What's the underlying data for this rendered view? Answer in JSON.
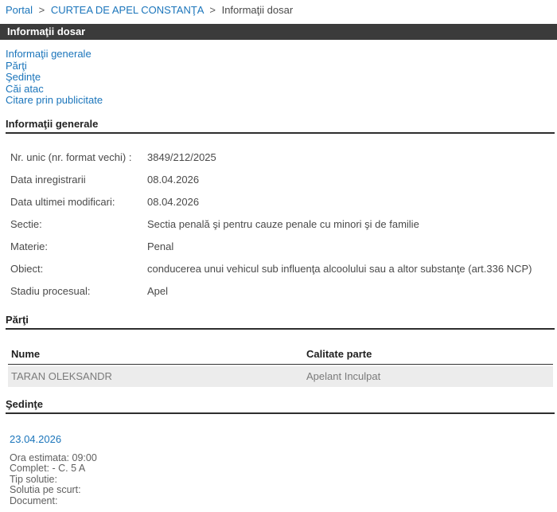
{
  "breadcrumb": {
    "separator": ">",
    "items": [
      {
        "label": "Portal"
      },
      {
        "label": "CURTEA DE APEL CONSTANŢA"
      },
      {
        "label": "Informaţii dosar"
      }
    ]
  },
  "header_bar": {
    "title": "Informaţii dosar"
  },
  "nav_links": {
    "general": "Informaţii generale",
    "parties": "Părţi",
    "hearings": "Şedinţe",
    "appeals": "Căi atac",
    "citation": "Citare prin publicitate"
  },
  "general_info": {
    "section_title": "Informaţii generale",
    "rows": [
      {
        "label": "Nr. unic (nr. format vechi) :",
        "value": "3849/212/2025"
      },
      {
        "label": "Data inregistrarii",
        "value": "08.04.2026"
      },
      {
        "label": "Data ultimei modificari:",
        "value": "08.04.2026"
      },
      {
        "label": "Sectie:",
        "value": "Sectia penală şi pentru cauze penale cu minori şi de familie"
      },
      {
        "label": "Materie:",
        "value": "Penal"
      },
      {
        "label": "Obiect:",
        "value": "conducerea unui vehicul sub influenţa alcoolului sau a altor substanţe (art.336 NCP)"
      },
      {
        "label": "Stadiu procesual:",
        "value": "Apel"
      }
    ]
  },
  "parties": {
    "section_title": "Părţi",
    "columns": {
      "name": "Nume",
      "role": "Calitate parte"
    },
    "rows": [
      {
        "name": "TARAN OLEKSANDR",
        "role": "Apelant Inculpat"
      }
    ]
  },
  "hearings": {
    "section_title": "Şedinţe",
    "entries": [
      {
        "date": "23.04.2026",
        "details": {
          "time": "Ora estimata: 09:00",
          "panel": "Complet: - C. 5 A",
          "solution_type": "Tip solutie:",
          "solution_summary": "Solutia pe scurt:",
          "document": "Document:"
        }
      }
    ]
  },
  "colors": {
    "link_blue": "#1b75bb",
    "header_bar_bg": "#3b3b3b",
    "header_bar_text": "#ffffff",
    "section_rule": "#2e2e2e",
    "row_stripe_bg": "#ececec",
    "row_stripe_text": "#7b7b7b",
    "body_text": "#4a4a4a"
  }
}
